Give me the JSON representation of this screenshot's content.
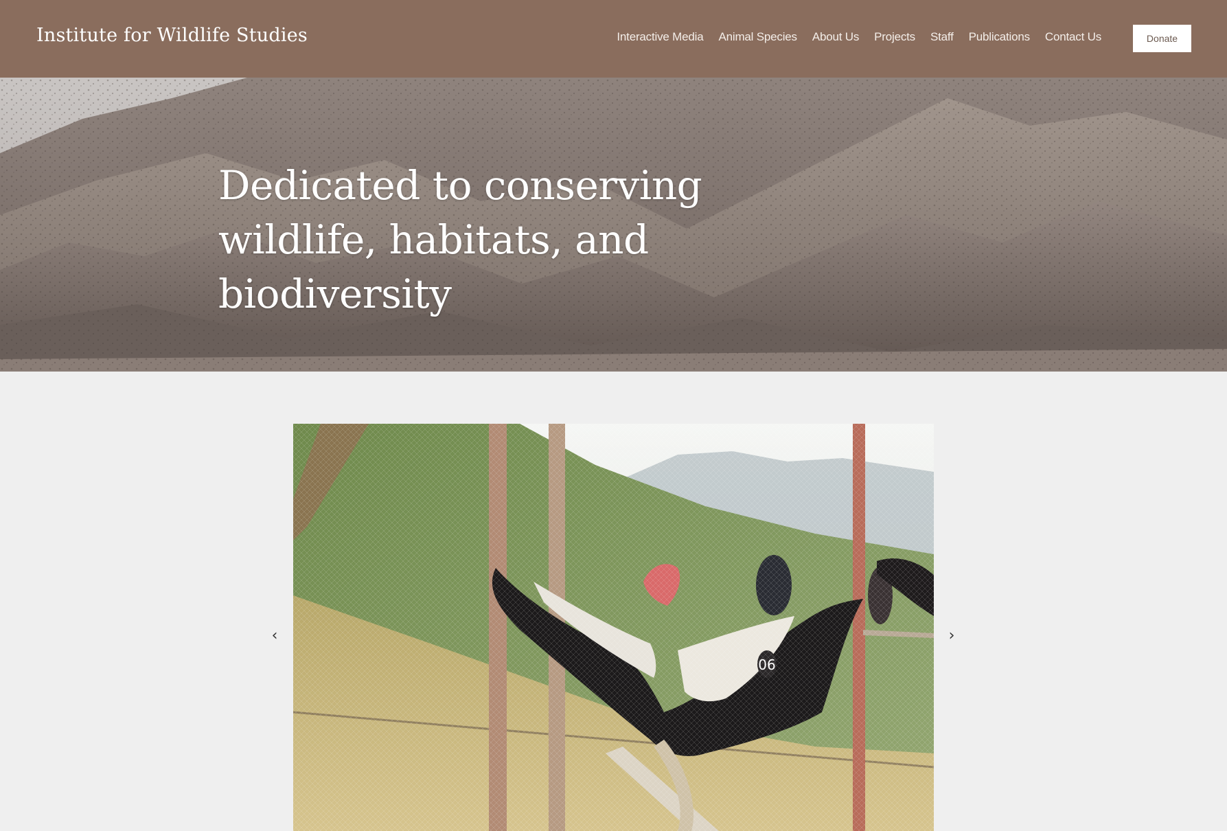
{
  "header": {
    "site_title": "Institute for Wildlife Studies",
    "nav": [
      "Interactive Media",
      "Animal Species",
      "About Us",
      "Projects",
      "Staff",
      "Publications",
      "Contact Us"
    ],
    "donate_label": "Donate"
  },
  "hero": {
    "heading": "Dedicated to conserving wildlife, habitats, and biodiversity"
  },
  "gallery": {
    "prev_icon": "chevron-left-icon",
    "next_icon": "chevron-right-icon",
    "prev_glyph": "‹",
    "next_glyph": "›",
    "tag_number": "06"
  },
  "colors": {
    "header_bg": "#8a6d5d",
    "page_bg": "#efefef",
    "text_light": "#ffffff"
  }
}
